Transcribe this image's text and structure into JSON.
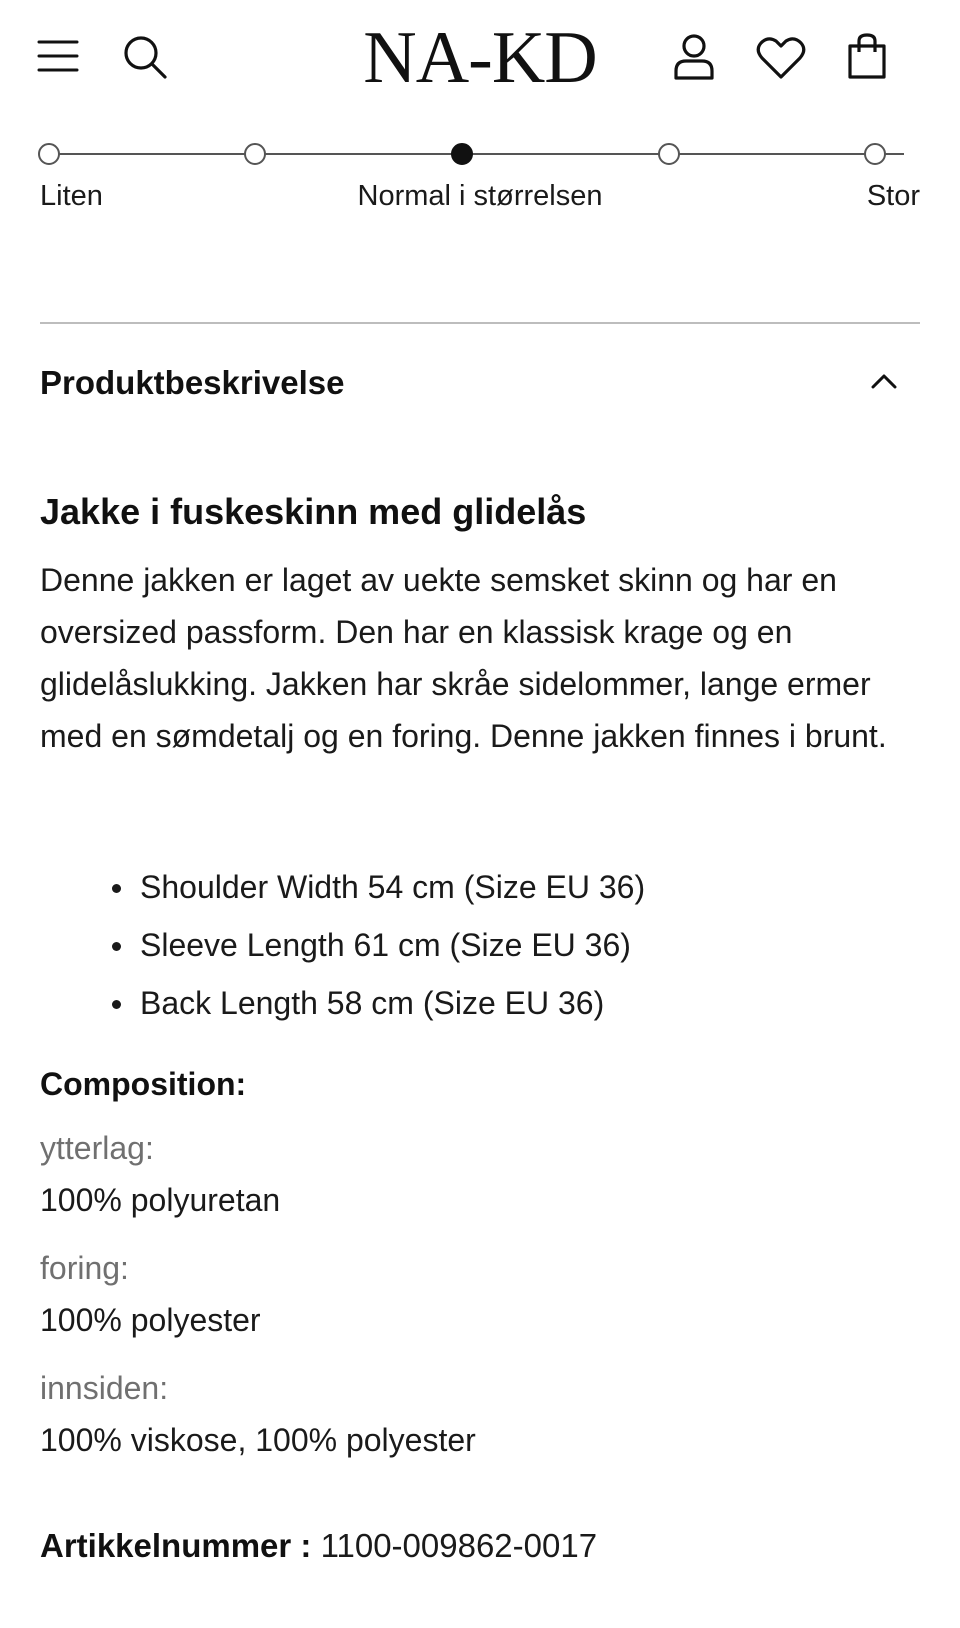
{
  "header": {
    "logo": "NA-KD",
    "icons": [
      "menu-icon",
      "search-icon",
      "account-icon",
      "wishlist-icon",
      "cart-icon"
    ]
  },
  "fit_scale": {
    "labels": {
      "left": "Liten",
      "middle": "Normal i størrelsen",
      "right": "Stor"
    },
    "steps": 5,
    "selected_step": 3
  },
  "accordion": {
    "title": "Produktbeskrivelse",
    "expanded": true
  },
  "product": {
    "title": "Jakke i fuskeskinn med glidelås",
    "description": "Denne jakken er laget av uekte semsket skinn og har en oversized passform. Den har en klassisk krage og en glidelåslukking. Jakken har skråe sidelommer, lange ermer med en sømdetalj og en foring. Denne jakken finnes i brunt.",
    "measurements": [
      "Shoulder Width 54 cm (Size EU 36)",
      "Sleeve Length 61 cm (Size EU 36)",
      "Back Length 58 cm (Size EU 36)"
    ]
  },
  "composition": {
    "title": "Composition:",
    "items": [
      {
        "label": "ytterlag:",
        "value": "100% polyuretan"
      },
      {
        "label": "foring:",
        "value": "100% polyester"
      },
      {
        "label": "innsiden:",
        "value": "100% viskose, 100% polyester"
      }
    ]
  },
  "article": {
    "label": "Artikkelnummer :",
    "value": "1100-009862-0017"
  },
  "colors": {
    "text": "#141414",
    "muted": "#707070",
    "divider": "#bdbdbd"
  }
}
